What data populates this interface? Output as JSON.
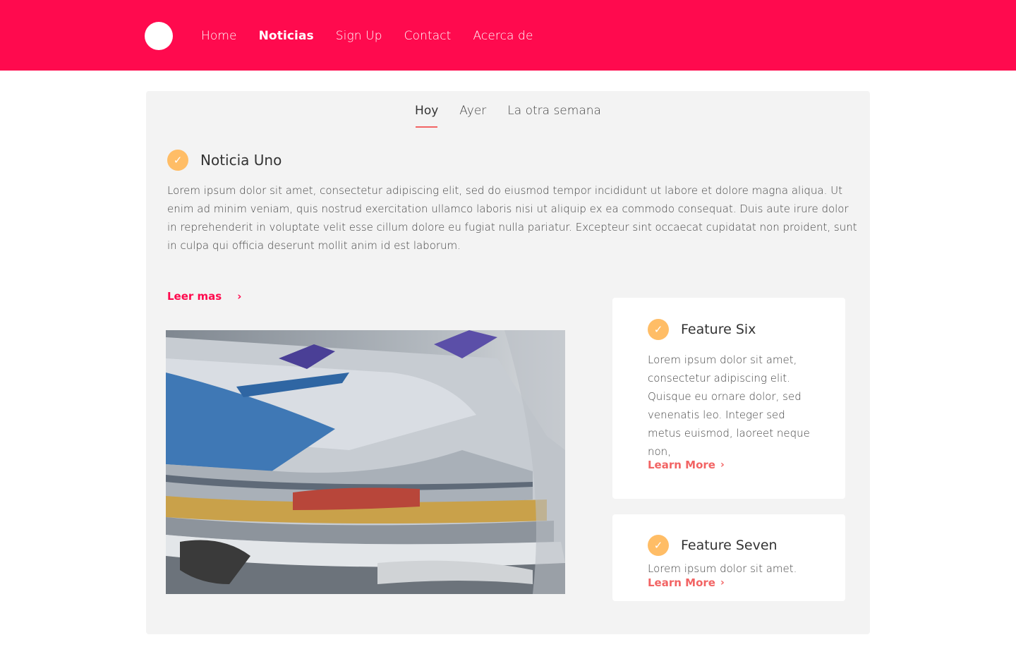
{
  "nav": {
    "items": [
      "Home",
      "Noticias",
      "Sign Up",
      "Contact",
      "Acerca de"
    ],
    "active": "Noticias"
  },
  "tabs": [
    "Hoy",
    "Ayer",
    "La otra semana"
  ],
  "article": {
    "title": "Noticia Uno",
    "body": "Lorem ipsum dolor sit amet, consectetur adipiscing elit, sed do eiusmod tempor incididunt ut labore et dolore magna aliqua. Ut enim ad minim veniam, quis nostrud exercitation ullamco laboris nisi ut aliquip ex ea commodo consequat. Duis aute irure dolor in reprehenderit in voluptate velit esse cillum dolore eu fugiat nulla pariatur. Excepteur sint occaecat cupidatat non proident, sunt in culpa qui officia deserunt mollit anim id est laborum.",
    "read_more": "Leer mas",
    "image": "newspaper-stack-photo"
  },
  "features": [
    {
      "title": "Feature Six",
      "text": "Lorem ipsum dolor sit amet, consectetur adipiscing elit. Quisque eu ornare dolor, sed venenatis leo. Integer sed metus euismod, laoreet neque non,",
      "link": "Learn More"
    },
    {
      "title": "Feature Seven",
      "text": "Lorem ipsum dolor sit amet.",
      "link": "Learn More"
    }
  ],
  "colors": {
    "brand": "#ff0a4e",
    "accent": "#f26464",
    "check": "#ffbd66",
    "panel": "#f3f3f3"
  }
}
